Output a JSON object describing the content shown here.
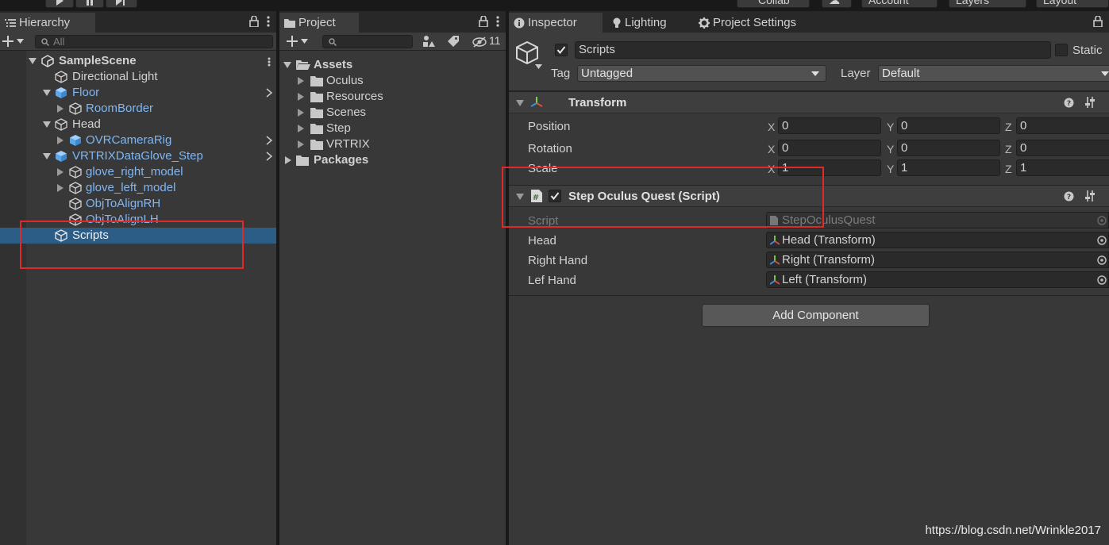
{
  "toolbar": {
    "collab_label": "Collab",
    "account_label": "Account",
    "layers_label": "Layers",
    "layout_label": "Layout"
  },
  "hierarchy": {
    "tab_label": "Hierarchy",
    "search_placeholder": "All",
    "scene_name": "SampleScene",
    "items": [
      {
        "label": "Directional Light"
      },
      {
        "label": "Floor"
      },
      {
        "label": "RoomBorder"
      },
      {
        "label": "Head"
      },
      {
        "label": "OVRCameraRig"
      },
      {
        "label": "VRTRIXDataGlove_Step"
      },
      {
        "label": "glove_right_model"
      },
      {
        "label": "glove_left_model"
      },
      {
        "label": "ObjToAlignRH"
      },
      {
        "label": "ObjToAlignLH"
      },
      {
        "label": "Scripts"
      }
    ]
  },
  "project": {
    "tab_label": "Project",
    "hidden_count": "11",
    "assets_label": "Assets",
    "folders": [
      {
        "label": "Oculus"
      },
      {
        "label": "Resources"
      },
      {
        "label": "Scenes"
      },
      {
        "label": "Step"
      },
      {
        "label": "VRTRIX"
      }
    ],
    "packages_label": "Packages"
  },
  "inspector": {
    "tabs": [
      {
        "label": "Inspector"
      },
      {
        "label": "Lighting"
      },
      {
        "label": "Project Settings"
      }
    ],
    "object_name": "Scripts",
    "static_label": "Static",
    "tag_label": "Tag",
    "tag_value": "Untagged",
    "layer_label": "Layer",
    "layer_value": "Default",
    "transform": {
      "title": "Transform",
      "rows": [
        {
          "label": "Position",
          "x": "0",
          "y": "0",
          "z": "0"
        },
        {
          "label": "Rotation",
          "x": "0",
          "y": "0",
          "z": "0"
        },
        {
          "label": "Scale",
          "x": "1",
          "y": "1",
          "z": "1"
        }
      ],
      "axis_x": "X",
      "axis_y": "Y",
      "axis_z": "Z"
    },
    "script_component": {
      "title": "Step Oculus Quest (Script)",
      "script_label": "Script",
      "script_value": "StepOculusQuest",
      "fields": [
        {
          "label": "Head",
          "value": "Head (Transform)"
        },
        {
          "label": "Right Hand",
          "value": "Right (Transform)"
        },
        {
          "label": "Lef Hand",
          "value": "Left (Transform)"
        }
      ]
    },
    "add_component_label": "Add Component"
  },
  "watermark": "https://blog.csdn.net/Wrinkle2017",
  "colors": {
    "selection": "#2c5d87",
    "prefab_blue": "#7fb6f3",
    "annotation_red": "#e02a2a"
  }
}
